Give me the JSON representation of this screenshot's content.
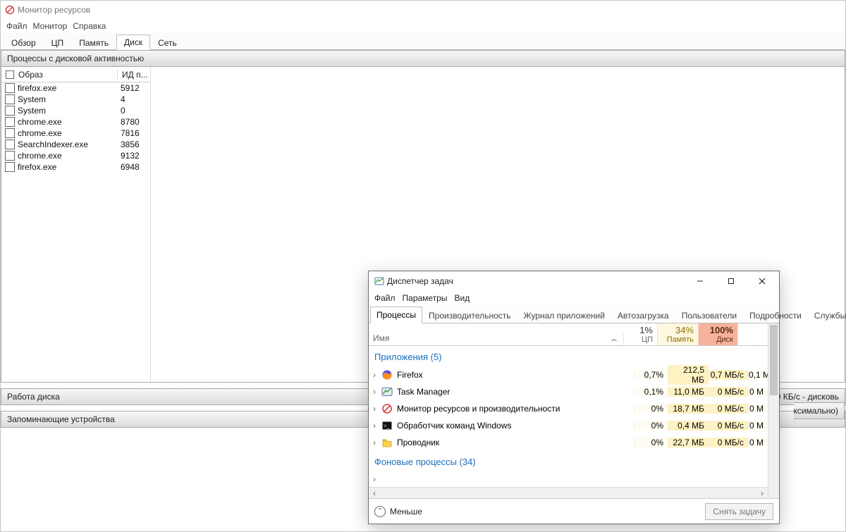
{
  "resmon": {
    "title": "Монитор ресурсов",
    "menu": {
      "file": "Файл",
      "monitor": "Монитор",
      "help": "Справка"
    },
    "tabs": {
      "overview": "Обзор",
      "cpu": "ЦП",
      "memory": "Память",
      "disk": "Диск",
      "network": "Сеть",
      "active": "disk"
    },
    "sections": {
      "processes": "Процессы с дисковой активностью",
      "disk_activity": "Работа диска",
      "storage": "Запоминающие устройства",
      "disk_status": "0 КБ/с - дисковь",
      "max_label": "ксимально)"
    },
    "columns": {
      "image": "Образ",
      "pid": "ИД п..."
    },
    "procs": [
      {
        "name": "firefox.exe",
        "pid": "5912"
      },
      {
        "name": "System",
        "pid": "4"
      },
      {
        "name": "System",
        "pid": "0"
      },
      {
        "name": "chrome.exe",
        "pid": "8780"
      },
      {
        "name": "chrome.exe",
        "pid": "7816"
      },
      {
        "name": "SearchIndexer.exe",
        "pid": "3856"
      },
      {
        "name": "chrome.exe",
        "pid": "9132"
      },
      {
        "name": "firefox.exe",
        "pid": "6948"
      }
    ]
  },
  "taskmgr": {
    "title": "Диспетчер задач",
    "menu": {
      "file": "Файл",
      "options": "Параметры",
      "view": "Вид"
    },
    "tabs": [
      "Процессы",
      "Производительность",
      "Журнал приложений",
      "Автозагрузка",
      "Пользователи",
      "Подробности",
      "Службы"
    ],
    "active_tab": 0,
    "header": {
      "name": "Имя",
      "cpu": {
        "pct": "1%",
        "lbl": "ЦП"
      },
      "mem": {
        "pct": "34%",
        "lbl": "Память"
      },
      "dsk": {
        "pct": "100%",
        "lbl": "Диск"
      }
    },
    "section_apps": "Приложения (5)",
    "section_bg": "Фоновые процессы (34)",
    "rows": [
      {
        "icon": "firefox",
        "name": "Firefox",
        "cpu": "0,7%",
        "mem": "212,5 МБ",
        "dsk": "0,7 МБ/с",
        "net": "0,1 М"
      },
      {
        "icon": "taskmgr",
        "name": "Task Manager",
        "cpu": "0,1%",
        "mem": "11,0 МБ",
        "dsk": "0 МБ/с",
        "net": "0 М"
      },
      {
        "icon": "resmon",
        "name": "Монитор ресурсов и производительности",
        "cpu": "0%",
        "mem": "18,7 МБ",
        "dsk": "0 МБ/с",
        "net": "0 М"
      },
      {
        "icon": "cmd",
        "name": "Обработчик команд Windows",
        "cpu": "0%",
        "mem": "0,4 МБ",
        "dsk": "0 МБ/с",
        "net": "0 М"
      },
      {
        "icon": "explorer",
        "name": "Проводник",
        "cpu": "0%",
        "mem": "22,7 МБ",
        "dsk": "0 МБ/с",
        "net": "0 М"
      }
    ],
    "bg_row": {
      "name": "",
      "cpu": "",
      "mem": "",
      "dsk": "",
      "net": ""
    },
    "footer": {
      "less": "Меньше",
      "end": "Снять задачу"
    }
  }
}
